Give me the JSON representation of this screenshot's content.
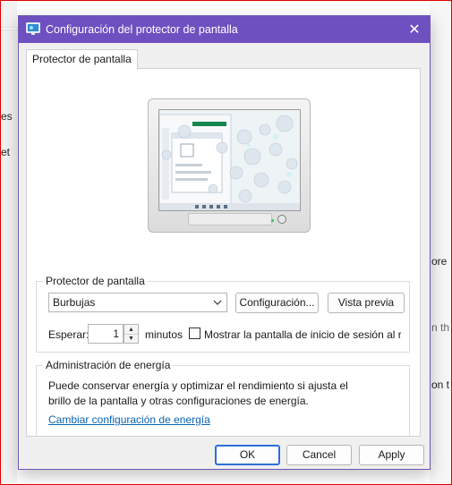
{
  "background": {
    "item1_partial": "es",
    "item2_partial": "et",
    "right1_partial": "ore",
    "right2_partial": "n th",
    "right3_partial": "on t"
  },
  "dialog": {
    "title": "Configuración del protector de pantalla",
    "close_glyph": "✕",
    "tab_label": "Protector de pantalla",
    "screensaver_group": {
      "label": "Protector de pantalla",
      "selected_screensaver": "Burbujas",
      "settings_button": "Configuración...",
      "preview_button": "Vista previa",
      "wait_label": "Esperar:",
      "wait_value": "1",
      "minutes_label": "minutos",
      "show_logon_checked": false,
      "show_logon_label": "Mostrar la pantalla de inicio de sesión al reanudar"
    },
    "power_group": {
      "label": "Administración de energía",
      "description": "Puede conservar energía y optimizar el rendimiento si ajusta el brillo de la pantalla y otras configuraciones de energía.",
      "link": "Cambiar configuración de energía"
    },
    "buttons": {
      "ok": "OK",
      "cancel": "Cancel",
      "apply": "Apply"
    }
  },
  "icons": {
    "title_icon": "screensaver-monitor-icon",
    "combo_chevron": "chevron-down-icon",
    "spin_up": "arrow-up-icon",
    "spin_down": "arrow-down-icon"
  },
  "colors": {
    "titlebar": "#6f50c0",
    "accent_border": "#2c6fd6",
    "link": "#0a64b4",
    "frame": "#e00000"
  }
}
